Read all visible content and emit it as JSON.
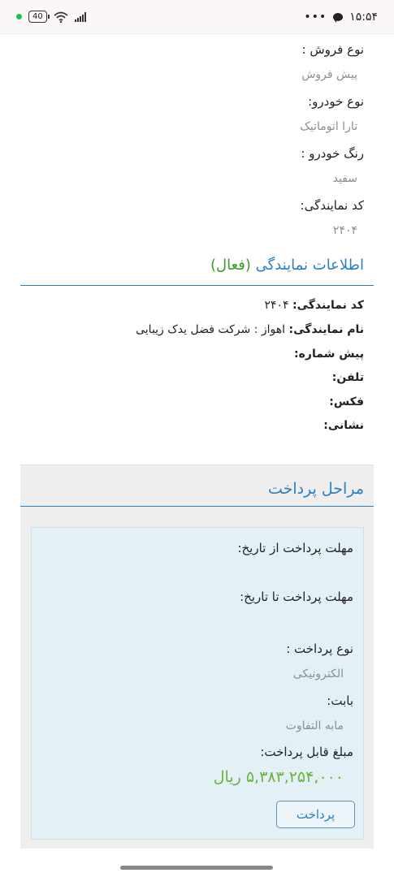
{
  "status_bar": {
    "time": "۱۵:۵۴",
    "overflow": "•••",
    "battery": "40"
  },
  "vehicle": {
    "sale_type_label": "نوع فروش :",
    "sale_type_value": "پیش فروش",
    "car_type_label": "نوع خودرو:",
    "car_type_value": "تارا اتوماتیک",
    "color_label": "رنگ خودرو :",
    "color_value": "سفید",
    "agency_code_label": "کد نمایندگی:",
    "agency_code_value": "۲۴۰۴"
  },
  "agency": {
    "title": "اطلاعات نمایندگی",
    "status": "(فعال)",
    "code_label": "کد نمایندگی:",
    "code_value": "۲۴۰۴",
    "name_label": "نام نمایندگی:",
    "name_value": "اهواز : شرکت فضل یدک زیبایی",
    "prefix_label": "پیش شماره:",
    "phone_label": "تلفن:",
    "fax_label": "فکس:",
    "address_label": "نشانی:"
  },
  "payment": {
    "title": "مراحل پرداخت",
    "deadline_from_label": "مهلت پرداخت از تاریخ:",
    "deadline_to_label": "مهلت پرداخت تا تاریخ:",
    "pay_type_label": "نوع پرداخت :",
    "pay_type_value": "الکترونیکی",
    "for_label": "بابت:",
    "for_value": "مابه التفاوت",
    "amount_label": "مبلغ قابل پرداخت:",
    "amount_value": "۵,۳۸۳,۲۵۴,۰۰۰ ریال",
    "pay_button": "پرداخت"
  },
  "colors": {
    "accent_blue": "#2a7fc4",
    "active_green": "#3a9a2e",
    "amount_green": "#6ab33a"
  }
}
